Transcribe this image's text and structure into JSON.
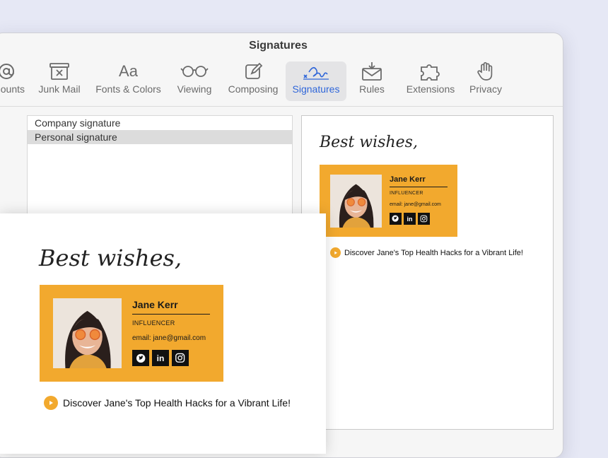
{
  "window": {
    "title": "Signatures"
  },
  "toolbar": {
    "items": [
      {
        "label": "Accounts",
        "icon": "at-icon"
      },
      {
        "label": "Junk Mail",
        "icon": "junk-mail-icon"
      },
      {
        "label": "Fonts & Colors",
        "icon": "fonts-icon"
      },
      {
        "label": "Viewing",
        "icon": "glasses-icon"
      },
      {
        "label": "Composing",
        "icon": "compose-icon"
      },
      {
        "label": "Signatures",
        "icon": "signature-icon",
        "active": true
      },
      {
        "label": "Rules",
        "icon": "rules-icon"
      },
      {
        "label": "Extensions",
        "icon": "puzzle-icon"
      },
      {
        "label": "Privacy",
        "icon": "hand-icon"
      }
    ],
    "accounts_visible": "ounts",
    "fonts_glyph": "Aa",
    "accent": "#2f66d9"
  },
  "signatures": [
    {
      "name": "Company signature",
      "selected": false
    },
    {
      "name": "Personal signature",
      "selected": true
    }
  ],
  "signature": {
    "greeting": "Best wishes,",
    "name": "Jane Kerr",
    "role": "INFLUENCER",
    "email": "email: jane@gmail.com",
    "socials": [
      "twitter-icon",
      "linkedin-icon",
      "instagram-icon"
    ],
    "linkedin_text": "in",
    "promo": "Discover Jane's Top Health Hacks for a Vibrant Life!",
    "card_color": "#f2a92e"
  }
}
